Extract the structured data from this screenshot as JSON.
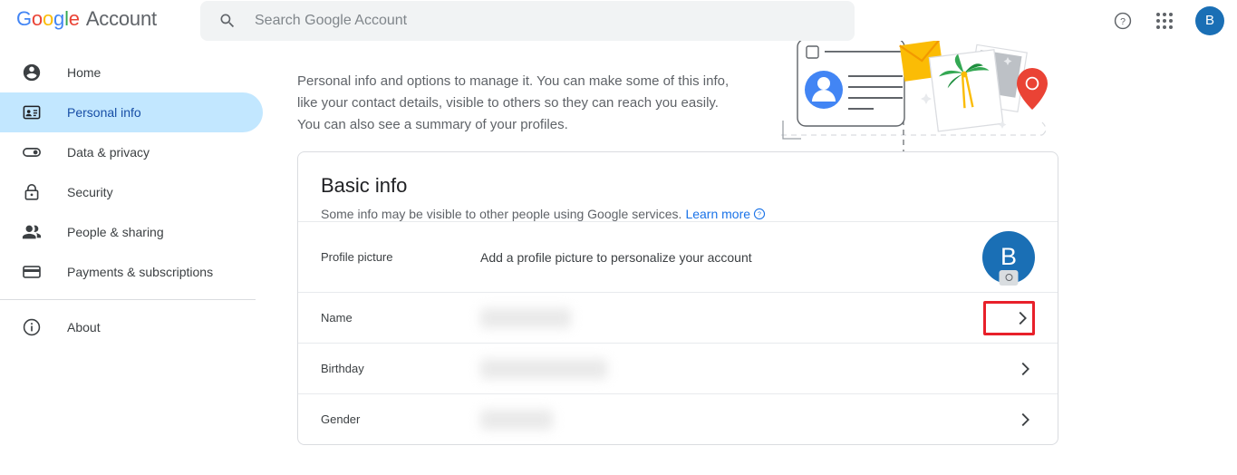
{
  "header": {
    "brand_google": [
      "G",
      "o",
      "o",
      "g",
      "l",
      "e"
    ],
    "brand_account": "Account",
    "search_placeholder": "Search Google Account",
    "search_value": "",
    "help_icon": "help-circle-icon",
    "apps_icon": "apps-grid-icon",
    "avatar_initial": "B",
    "avatar_color": "#1a6fb5"
  },
  "sidebar": {
    "items": [
      {
        "label": "Home",
        "icon": "account-circle-icon",
        "active": false
      },
      {
        "label": "Personal info",
        "icon": "badge-id-icon",
        "active": true
      },
      {
        "label": "Data & privacy",
        "icon": "toggle-switch-icon",
        "active": false
      },
      {
        "label": "Security",
        "icon": "lock-icon",
        "active": false
      },
      {
        "label": "People & sharing",
        "icon": "people-icon",
        "active": false
      },
      {
        "label": "Payments & subscriptions",
        "icon": "credit-card-icon",
        "active": false
      }
    ],
    "footer_items": [
      {
        "label": "About",
        "icon": "info-circle-icon",
        "active": false
      }
    ],
    "active_pill_color": "#c2e7ff",
    "active_text_color": "#174ea6"
  },
  "main": {
    "intro": "Personal info and options to manage it. You can make some of this info, like your contact details, visible to others so they can reach you easily. You can also see a summary of your profiles.",
    "illustration": "profile-card-photos-location-illustration"
  },
  "card": {
    "title": "Basic info",
    "subtitle": "Some info may be visible to other people using Google services.",
    "learn_more": "Learn more",
    "learn_more_color": "#1a73e8",
    "rows": [
      {
        "label": "Profile picture",
        "value": "Add a profile picture to personalize your account",
        "redacted": false,
        "type": "avatar",
        "avatar_initial": "B",
        "highlighted": false
      },
      {
        "label": "Name",
        "value": "",
        "redacted": true,
        "redact_width": 100,
        "type": "chevron",
        "highlighted": true
      },
      {
        "label": "Birthday",
        "value": "",
        "redacted": true,
        "redact_width": 140,
        "type": "chevron",
        "highlighted": false
      },
      {
        "label": "Gender",
        "value": "",
        "redacted": true,
        "redact_width": 80,
        "type": "chevron",
        "highlighted": false
      }
    ],
    "highlight_color": "#e8202a",
    "chevron_icon": "chevron-right-icon"
  }
}
